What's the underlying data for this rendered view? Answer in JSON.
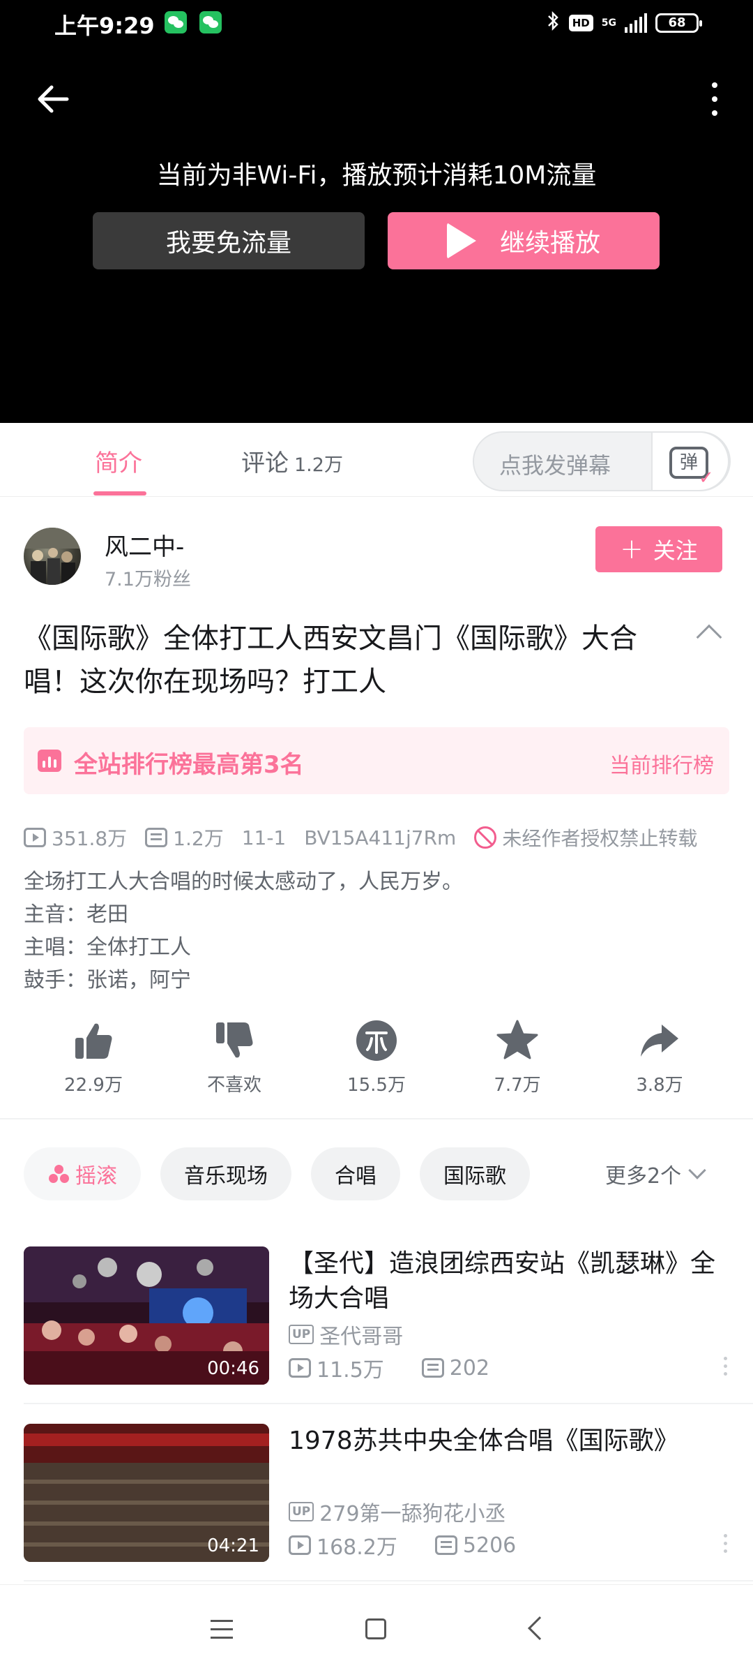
{
  "status_bar": {
    "time": "上午9:29",
    "hd": "HD",
    "network": "5G",
    "battery": "68"
  },
  "player": {
    "notice": "当前为非Wi-Fi，播放预计消耗10M流量",
    "free_data_button": "我要免流量",
    "continue_button": "继续播放"
  },
  "tabs": {
    "intro": "简介",
    "comments": "评论",
    "comments_count": "1.2万",
    "danmu_placeholder": "点我发弹幕",
    "danmu_icon_char": "弹"
  },
  "author": {
    "name": "风二中-",
    "fans": "7.1万粉丝",
    "follow": "关注"
  },
  "video": {
    "title": "《国际歌》全体打工人西安文昌门《国际歌》大合唱！这次你在现场吗？打工人",
    "rank_text": "全站排行榜最高第3名",
    "rank_link": "当前排行榜",
    "views": "351.8万",
    "danmaku": "1.2万",
    "date": "11-1",
    "bvid": "BV15A411j7Rm",
    "copyright": "未经作者授权禁止转载",
    "description": [
      "全场打工人大合唱的时候太感动了，人民万岁。",
      "主音：老田",
      "主唱：全体打工人",
      "鼓手：张诺，阿宁"
    ]
  },
  "actions": {
    "like": "22.9万",
    "dislike": "不喜欢",
    "coin": "15.5万",
    "favorite": "7.7万",
    "share": "3.8万"
  },
  "tags": [
    "摇滚",
    "音乐现场",
    "合唱",
    "国际歌"
  ],
  "tags_more": "更多2个",
  "related": [
    {
      "title": "【圣代】造浪团综西安站《凯瑟琳》全场大合唱",
      "up_badge": "UP",
      "up": "圣代哥哥",
      "views": "11.5万",
      "danmaku": "202",
      "duration": "00:46"
    },
    {
      "title": "1978苏共中央全体合唱《国际歌》",
      "up_badge": "UP",
      "up": "279第一舔狗花小丞",
      "views": "168.2万",
      "danmaku": "5206",
      "duration": "04:21"
    }
  ],
  "colors": {
    "accent": "#fb7299",
    "text": "#18191c",
    "muted": "#9499a0"
  }
}
